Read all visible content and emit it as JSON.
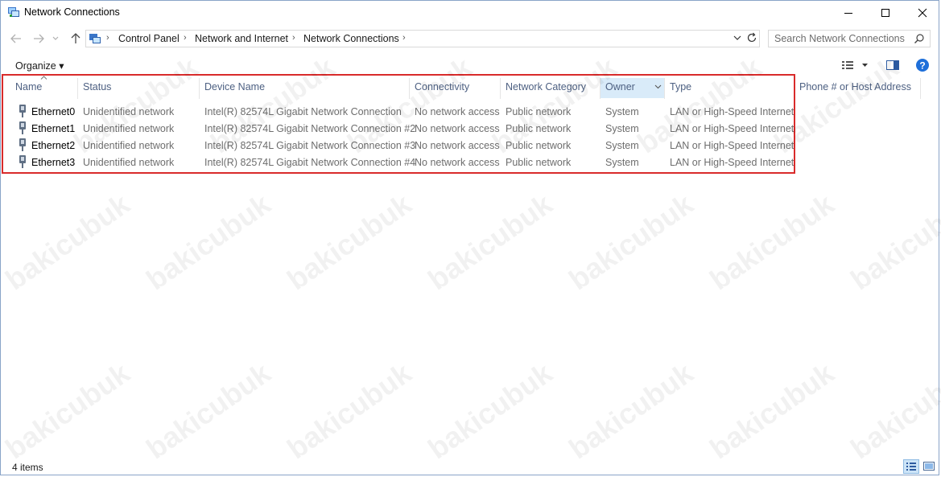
{
  "window": {
    "title": "Network Connections",
    "minimize_glyph": "—",
    "maximize_glyph": "☐",
    "close_glyph": "✕"
  },
  "address": {
    "crumbs": [
      "Control Panel",
      "Network and Internet",
      "Network Connections"
    ],
    "search_placeholder": "Search Network Connections"
  },
  "toolbar": {
    "organize_label": "Organize ▾"
  },
  "columns": [
    "Name",
    "Status",
    "Device Name",
    "Connectivity",
    "Network Category",
    "Owner",
    "Type",
    "Phone # or Host Address"
  ],
  "rows": [
    {
      "name": "Ethernet0",
      "status": "Unidentified network",
      "device": "Intel(R) 82574L Gigabit Network Connection",
      "connectivity": "No network access",
      "category": "Public network",
      "owner": "System",
      "type": "LAN or High-Speed Internet"
    },
    {
      "name": "Ethernet1",
      "status": "Unidentified network",
      "device": "Intel(R) 82574L Gigabit Network Connection #2",
      "connectivity": "No network access",
      "category": "Public network",
      "owner": "System",
      "type": "LAN or High-Speed Internet"
    },
    {
      "name": "Ethernet2",
      "status": "Unidentified network",
      "device": "Intel(R) 82574L Gigabit Network Connection #3",
      "connectivity": "No network access",
      "category": "Public network",
      "owner": "System",
      "type": "LAN or High-Speed Internet"
    },
    {
      "name": "Ethernet3",
      "status": "Unidentified network",
      "device": "Intel(R) 82574L Gigabit Network Connection #4",
      "connectivity": "No network access",
      "category": "Public network",
      "owner": "System",
      "type": "LAN or High-Speed Internet"
    }
  ],
  "statusbar": {
    "count": "4 items"
  },
  "watermark": "bakicubuk",
  "colors": {
    "accent": "#1e6fd9",
    "highlight_box": "#d92b2b",
    "header_text": "#4d6082"
  },
  "icons": [
    "network-connections-icon",
    "back-arrow-icon",
    "forward-arrow-icon",
    "recent-dropdown-icon",
    "up-arrow-icon",
    "refresh-icon",
    "search-icon",
    "view-options-icon",
    "preview-pane-icon",
    "help-icon",
    "ethernet-icon",
    "details-view-icon",
    "large-icons-view-icon"
  ]
}
